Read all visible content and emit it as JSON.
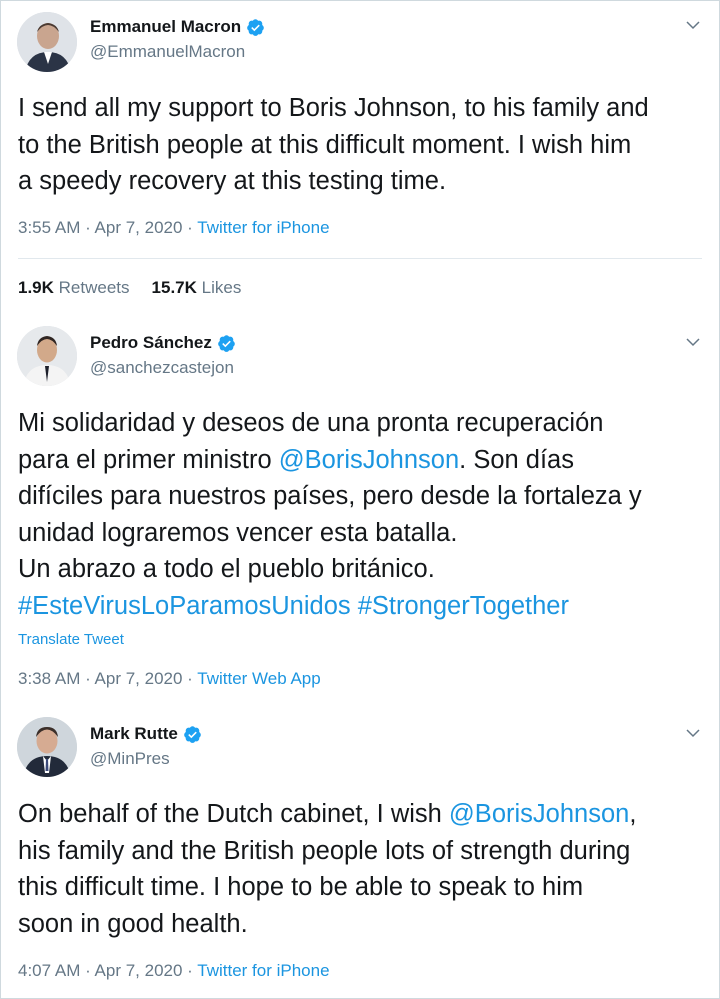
{
  "tweets": [
    {
      "name": "Emmanuel Macron",
      "handle": "@EmmanuelMacron",
      "verified": true,
      "lines": [
        [
          {
            "t": "I send all my support to Boris Johnson, to his family and"
          }
        ],
        [
          {
            "t": "to the British people at this difficult moment. I wish him"
          }
        ],
        [
          {
            "t": "a speedy recovery at this testing time."
          }
        ]
      ],
      "time": "3:55 AM · Apr 7, 2020 · ",
      "source": "Twitter for iPhone",
      "retweets_count": "1.9K",
      "retweets_label": "Retweets",
      "likes_count": "15.7K",
      "likes_label": "Likes"
    },
    {
      "name": "Pedro Sánchez",
      "handle": "@sanchezcastejon",
      "verified": true,
      "lines": [
        [
          {
            "t": "Mi solidaridad y deseos de una pronta recuperación"
          }
        ],
        [
          {
            "t": "para el primer ministro "
          },
          {
            "t": "@BorisJohnson",
            "link": true
          },
          {
            "t": ". Son días"
          }
        ],
        [
          {
            "t": "difíciles para nuestros países, pero desde la fortaleza y"
          }
        ],
        [
          {
            "t": "unidad lograremos vencer esta batalla."
          }
        ],
        [
          {
            "t": "Un abrazo a todo el pueblo británico."
          }
        ],
        [
          {
            "t": "#EsteVirusLoParamosUnidos",
            "link": true
          },
          {
            "t": " "
          },
          {
            "t": "#StrongerTogether",
            "link": true
          }
        ]
      ],
      "translate": "Translate Tweet",
      "time": "3:38 AM · Apr 7, 2020 · ",
      "source": "Twitter Web App"
    },
    {
      "name": "Mark Rutte",
      "handle": "@MinPres",
      "verified": true,
      "lines": [
        [
          {
            "t": "On behalf of the Dutch cabinet, I wish "
          },
          {
            "t": "@BorisJohnson",
            "link": true
          },
          {
            "t": ","
          }
        ],
        [
          {
            "t": "his family and the British people lots of strength during"
          }
        ],
        [
          {
            "t": "this difficult time. I hope to be able to speak to him"
          }
        ],
        [
          {
            "t": "soon in good health."
          }
        ]
      ],
      "time": "4:07 AM · Apr 7, 2020 · ",
      "source": "Twitter for iPhone"
    }
  ],
  "colors": {
    "link": "#1b95e0",
    "verified": "#1da1f2",
    "secondary": "#657786",
    "text": "#14171a"
  }
}
